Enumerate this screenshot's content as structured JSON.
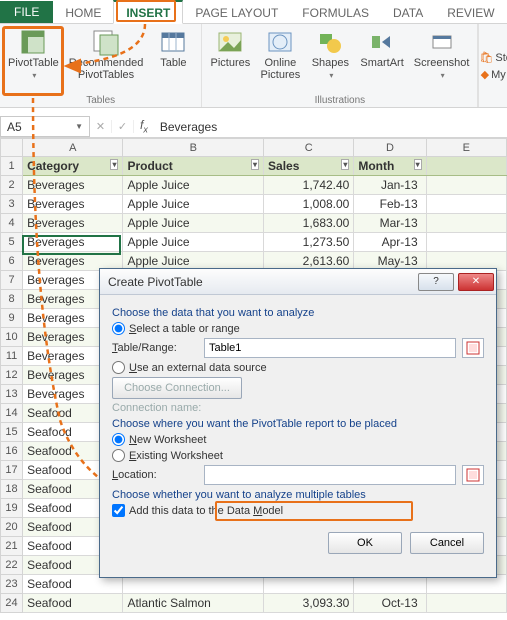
{
  "tabs": {
    "file": "FILE",
    "home": "HOME",
    "insert": "INSERT",
    "pagelayout": "PAGE LAYOUT",
    "formulas": "FORMULAS",
    "data": "DATA",
    "review": "REVIEW"
  },
  "ribbon": {
    "pivottable": "PivotTable",
    "recommended_pivottables": "Recommended\nPivotTables",
    "table": "Table",
    "pictures": "Pictures",
    "online_pictures": "Online\nPictures",
    "shapes": "Shapes",
    "smartart": "SmartArt",
    "screenshot": "Screenshot",
    "group_tables": "Tables",
    "group_illustrations": "Illustrations",
    "store": "Stor",
    "myapps": "My A"
  },
  "namebox": "A5",
  "formula_value": "Beverages",
  "columns": {
    "A": "A",
    "B": "B",
    "C": "C",
    "D": "D",
    "E": "E"
  },
  "headers": {
    "category": "Category",
    "product": "Product",
    "sales": "Sales",
    "month": "Month"
  },
  "rows": [
    {
      "n": 2,
      "cat": "Beverages",
      "prod": "Apple Juice",
      "sales": "1,742.40",
      "month": "Jan-13"
    },
    {
      "n": 3,
      "cat": "Beverages",
      "prod": "Apple Juice",
      "sales": "1,008.00",
      "month": "Feb-13"
    },
    {
      "n": 4,
      "cat": "Beverages",
      "prod": "Apple Juice",
      "sales": "1,683.00",
      "month": "Mar-13"
    },
    {
      "n": 5,
      "cat": "Beverages",
      "prod": "Apple Juice",
      "sales": "1,273.50",
      "month": "Apr-13"
    },
    {
      "n": 6,
      "cat": "Beverages",
      "prod": "Apple Juice",
      "sales": "2,613.60",
      "month": "May-13"
    },
    {
      "n": 7,
      "cat": "Beverages",
      "prod": "",
      "sales": "",
      "month": ""
    },
    {
      "n": 8,
      "cat": "Beverages",
      "prod": "",
      "sales": "",
      "month": ""
    },
    {
      "n": 9,
      "cat": "Beverages",
      "prod": "",
      "sales": "",
      "month": ""
    },
    {
      "n": 10,
      "cat": "Beverages",
      "prod": "",
      "sales": "",
      "month": ""
    },
    {
      "n": 11,
      "cat": "Beverages",
      "prod": "",
      "sales": "",
      "month": ""
    },
    {
      "n": 12,
      "cat": "Beverages",
      "prod": "",
      "sales": "",
      "month": ""
    },
    {
      "n": 13,
      "cat": "Beverages",
      "prod": "",
      "sales": "",
      "month": ""
    },
    {
      "n": 14,
      "cat": "Seafood",
      "prod": "",
      "sales": "",
      "month": ""
    },
    {
      "n": 15,
      "cat": "Seafood",
      "prod": "",
      "sales": "",
      "month": ""
    },
    {
      "n": 16,
      "cat": "Seafood",
      "prod": "",
      "sales": "",
      "month": ""
    },
    {
      "n": 17,
      "cat": "Seafood",
      "prod": "",
      "sales": "",
      "month": ""
    },
    {
      "n": 18,
      "cat": "Seafood",
      "prod": "",
      "sales": "",
      "month": ""
    },
    {
      "n": 19,
      "cat": "Seafood",
      "prod": "",
      "sales": "",
      "month": ""
    },
    {
      "n": 20,
      "cat": "Seafood",
      "prod": "",
      "sales": "",
      "month": ""
    },
    {
      "n": 21,
      "cat": "Seafood",
      "prod": "",
      "sales": "",
      "month": ""
    },
    {
      "n": 22,
      "cat": "Seafood",
      "prod": "",
      "sales": "",
      "month": ""
    },
    {
      "n": 23,
      "cat": "Seafood",
      "prod": "",
      "sales": "",
      "month": ""
    },
    {
      "n": 24,
      "cat": "Seafood",
      "prod": "Atlantic Salmon",
      "sales": "3,093.30",
      "month": "Oct-13"
    }
  ],
  "dialog": {
    "title": "Create PivotTable",
    "sec_choose_data": "Choose the data that you want to analyze",
    "opt_select_table": "Select a table or range",
    "lbl_table_range": "Table/Range:",
    "val_table_range": "Table1",
    "opt_external": "Use an external data source",
    "btn_choose_conn": "Choose Connection...",
    "lbl_conn_name": "Connection name:",
    "sec_choose_where": "Choose where you want the PivotTable report to be placed",
    "opt_new_ws": "New Worksheet",
    "opt_existing_ws": "Existing Worksheet",
    "lbl_location": "Location:",
    "sec_multiple": "Choose whether you want to analyze multiple tables",
    "chk_datamodel": "Add this data to the Data Model",
    "btn_ok": "OK",
    "btn_cancel": "Cancel"
  }
}
